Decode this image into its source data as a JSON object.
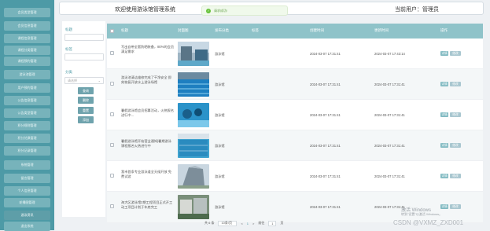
{
  "sidebar": {
    "items": [
      {
        "label": "会员类型管理"
      },
      {
        "label": "会员信息管理"
      },
      {
        "label": "课程信息管理"
      },
      {
        "label": "课程分类管理"
      },
      {
        "label": "课程预约管理"
      },
      {
        "label": "游泳池管理"
      },
      {
        "label": "用户预约管理"
      },
      {
        "label": "公告信息管理"
      },
      {
        "label": "公告类型管理"
      },
      {
        "label": "积分规则管理"
      },
      {
        "label": "积分兑换管理"
      },
      {
        "label": "积分记录管理"
      },
      {
        "label": "系统管理"
      },
      {
        "label": "留言管理"
      },
      {
        "label": "个人信息管理"
      },
      {
        "label": "轮播图管理"
      },
      {
        "label": "游泳资讯",
        "active": true
      },
      {
        "label": "退出系统"
      }
    ]
  },
  "header": {
    "title": "欢迎使用游泳馆管理系统",
    "user": "当前用户：管理员"
  },
  "toast": {
    "icon": "check-icon",
    "text": "请求成功!"
  },
  "filter": {
    "title_label": "标题",
    "title_value": "",
    "tag_label": "标签",
    "tag_value": "",
    "category_label": "分类",
    "category_value": "请选择",
    "buttons": {
      "search": "查询",
      "delete": "删除",
      "reset": "重置",
      "add": "添加"
    }
  },
  "table": {
    "headers": [
      "",
      "标题",
      "封面图",
      "发布分类",
      "标签",
      "创建时间",
      "更新时间",
      "操作"
    ],
    "rows": [
      {
        "title": "写出自带全套防晒装备，80%的会员满足需求",
        "category": "游泳馆",
        "tag": "",
        "created": "2024-03-07 17:31:41",
        "updated": "2024-03-07 17:43:14"
      },
      {
        "title": "游泳池清洁维修完成了干净安全 即刻恢复开放水上游泳场馆",
        "category": "游泳馆",
        "tag": "",
        "created": "2024-03-07 17:31:41",
        "updated": "2024-03-07 17:31:41"
      },
      {
        "title": "暑假游泳馆会员招募活动，火热报名进行中...",
        "category": "游泳馆",
        "tag": "",
        "created": "2024-03-07 17:31:41",
        "updated": "2024-03-07 17:31:41"
      },
      {
        "title": "暑假游泳馆开始营业通知|暑期游泳课程报名火热进行中",
        "category": "游泳馆",
        "tag": "",
        "created": "2024-03-07 17:31:41",
        "updated": "2024-03-07 17:31:41"
      },
      {
        "title": "我市首条专业游泳道全天候开放 免费试游",
        "category": "游泳馆",
        "tag": "",
        "created": "2024-03-07 17:31:41",
        "updated": "2024-03-07 17:31:41"
      },
      {
        "title": "海大区游泳馆2期工程项目正式开工动工项目计划于年底完工",
        "category": "游泳馆",
        "tag": "",
        "created": "2024-03-07 17:31:41",
        "updated": "2024-03-07 17:31:41"
      }
    ],
    "actions": {
      "detail": "详情",
      "edit": "修改"
    }
  },
  "pager": {
    "total": "共 6 条",
    "page_size": "10条/页",
    "prev": "<",
    "page": "1",
    "next": ">",
    "goto": "前往",
    "goto_value": "1",
    "page_unit": "页"
  },
  "watermark": {
    "win_line1": "激活 Windows",
    "win_line2": "转到\"设置\"以激活 Windows。",
    "csdn": "CSDN @VXMZ_ZXD001"
  },
  "colors": {
    "sidebar": "#4d9aa6",
    "accent": "#8fc3c9",
    "detail_btn": "#7fb9c1",
    "edit_btn": "#a9c7d0"
  }
}
